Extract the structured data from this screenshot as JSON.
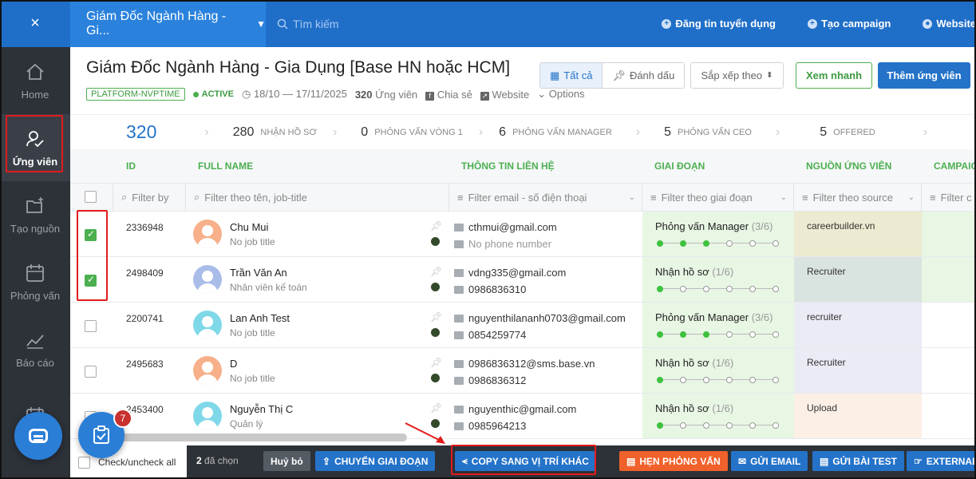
{
  "topbar": {
    "close": "×",
    "job_select": "Giám Đốc Ngành Hàng - Gi...",
    "search_placeholder": "Tìm kiếm",
    "post_job": "Đăng tin tuyển dụng",
    "create_campaign": "Tạo campaign",
    "website": "Website"
  },
  "sidebar": {
    "items": [
      {
        "label": "Home",
        "icon": "home-icon"
      },
      {
        "label": "Ứng viên",
        "icon": "candidate-icon"
      },
      {
        "label": "Tạo nguồn",
        "icon": "folder-plus-icon"
      },
      {
        "label": "Phỏng vấn",
        "icon": "calendar-icon"
      },
      {
        "label": "Báo cáo",
        "icon": "chart-line-icon"
      }
    ]
  },
  "header": {
    "title": "Giám Đốc Ngành Hàng - Gia Dụng [Base HN hoặc HCM]",
    "tag": "PLATFORM-NVPTIME",
    "status": "ACTIVE",
    "date_range": "18/10 — 17/11/2025",
    "candidate_count": "320",
    "candidate_label": "Ứng viên",
    "share": "Chia sẻ",
    "website": "Website",
    "options": "Options"
  },
  "toolbar": {
    "all": "Tất cả",
    "marked": "Đánh dấu",
    "sort": "Sắp xếp theo",
    "quick_view": "Xem nhanh",
    "add_candidate": "Thêm ứng viên"
  },
  "stages": {
    "total": "320",
    "items": [
      {
        "count": "280",
        "label": "Nhận hồ sơ"
      },
      {
        "count": "0",
        "label": "Phỏng vấn vòng 1"
      },
      {
        "count": "6",
        "label": "Phỏng vấn manager"
      },
      {
        "count": "5",
        "label": "Phỏng vấn CEO"
      },
      {
        "count": "5",
        "label": "Offered"
      }
    ]
  },
  "table": {
    "headers": {
      "id": "ID",
      "full_name": "FULL NAME",
      "contact": "THÔNG TIN LIÊN HỆ",
      "stage": "GIAI ĐOẠN",
      "source": "NGUỒN ỨNG VIÊN",
      "campaign": "CAMPAIGN"
    },
    "filters": {
      "id": "Filter by",
      "name": "Filter theo tên, job-title",
      "contact": "Filter email - số điện thoại",
      "stage": "Filter theo giai đoạn",
      "source": "Filter theo source",
      "campaign": "Filter c"
    },
    "rows": [
      {
        "id": "2336948",
        "name": "Chu Mui",
        "sub": "No job title",
        "email": "cthmui@gmail.com",
        "phone": "No phone number",
        "stage": "Phỏng vấn Manager",
        "stage_count": "(3/6)",
        "progress": 3,
        "source": "careerbuilder.vn",
        "checked": true,
        "avatar_color": "#f7b08a"
      },
      {
        "id": "2498409",
        "name": "Trần Văn An",
        "sub": "Nhân viên kế toán",
        "email": "vdng335@gmail.com",
        "phone": "0986836310",
        "stage": "Nhận hồ sơ",
        "stage_count": "(1/6)",
        "progress": 1,
        "source": "Recruiter",
        "checked": true,
        "avatar_color": "#a9bde8"
      },
      {
        "id": "2200741",
        "name": "Lan Anh Test",
        "sub": "No job title",
        "email": "nguyenthilananh0703@gmail.com",
        "phone": "0854259774",
        "stage": "Phỏng vấn Manager",
        "stage_count": "(3/6)",
        "progress": 3,
        "source": "recruiter",
        "checked": false,
        "avatar_color": "#7fd8e8"
      },
      {
        "id": "2495683",
        "name": "D",
        "sub": "No job title",
        "email": "0986836312@sms.base.vn",
        "phone": "0986836312",
        "stage": "Nhận hồ sơ",
        "stage_count": "(1/6)",
        "progress": 1,
        "source": "Recruiter",
        "checked": false,
        "avatar_color": "#f7b08a"
      },
      {
        "id": "2453400",
        "name": "Nguyễn Thị C",
        "sub": "Quản lý",
        "email": "nguyenthic@gmail.com",
        "phone": "0985964213",
        "stage": "Nhận hồ sơ",
        "stage_count": "(1/6)",
        "progress": 1,
        "source": "Upload",
        "checked": false,
        "avatar_color": "#7fd8e8"
      }
    ]
  },
  "bottombar": {
    "check_all": "Check/uncheck all",
    "selected_count": "2",
    "selected_label": "đã chọn",
    "cancel": "Huỷ bỏ",
    "move_stage": "CHUYỂN GIAI ĐOẠN",
    "copy_to_other": "COPY SANG VỊ TRÍ KHÁC",
    "schedule_interview": "HẸN PHỎNG VẤN",
    "send_email": "GỬI EMAIL",
    "send_test": "GỬI BÀI TEST",
    "external": "EXTERNAL"
  },
  "floating": {
    "task_badge": "7"
  },
  "colors": {
    "primary": "#1f6fc9",
    "green": "#4caf50",
    "orange": "#f0612b",
    "highlight_red": "#e31b1b"
  }
}
